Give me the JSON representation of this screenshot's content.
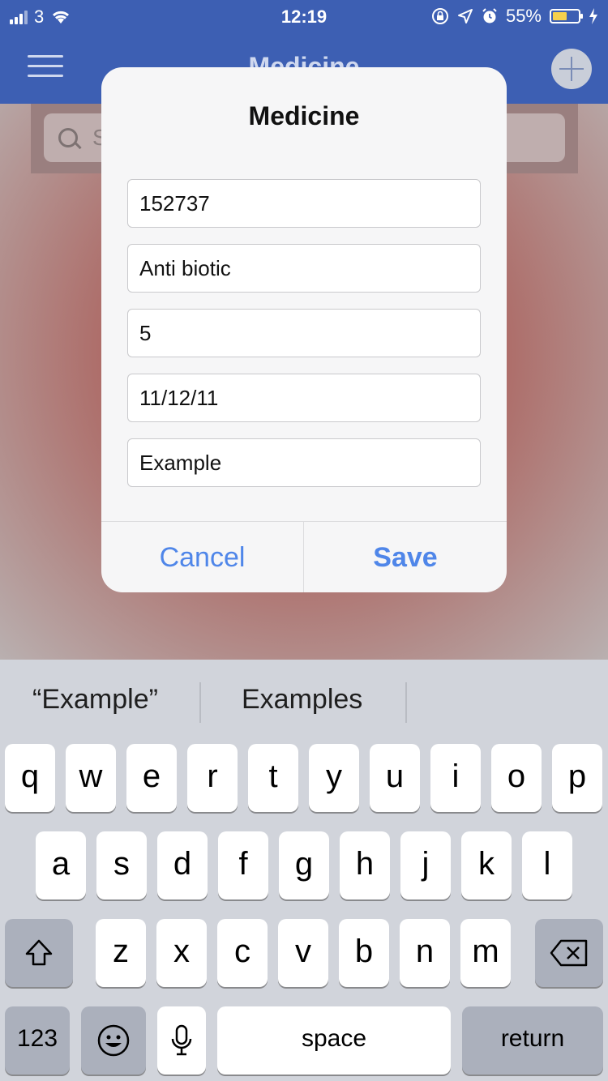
{
  "status_bar": {
    "carrier": "3",
    "time": "12:19",
    "battery_percent": "55%",
    "battery_level": 0.55,
    "icons": [
      "signal-icon",
      "wifi-icon",
      "orientation-lock-icon",
      "location-icon",
      "alarm-icon",
      "battery-icon",
      "charging-icon"
    ]
  },
  "nav": {
    "title": "Medicine",
    "menu_icon": "hamburger-menu-icon",
    "add_icon": "plus-icon"
  },
  "search": {
    "placeholder_fragment": "S"
  },
  "dialog": {
    "title": "Medicine",
    "fields": [
      {
        "value": "152737"
      },
      {
        "value": "Anti biotic"
      },
      {
        "value": "5"
      },
      {
        "value": "11/12/11"
      },
      {
        "value": "Example"
      }
    ],
    "cancel_label": "Cancel",
    "save_label": "Save"
  },
  "keyboard": {
    "suggestions": [
      "“Example”",
      "Examples"
    ],
    "row1": [
      "q",
      "w",
      "e",
      "r",
      "t",
      "y",
      "u",
      "i",
      "o",
      "p"
    ],
    "row2": [
      "a",
      "s",
      "d",
      "f",
      "g",
      "h",
      "j",
      "k",
      "l"
    ],
    "row3": [
      "z",
      "x",
      "c",
      "v",
      "b",
      "n",
      "m"
    ],
    "numbers_label": "123",
    "space_label": "space",
    "return_label": "return"
  },
  "colors": {
    "nav_blue": "#3d5fb3",
    "accent_blue": "#4f86e9",
    "battery_fill": "#f6d04d"
  }
}
